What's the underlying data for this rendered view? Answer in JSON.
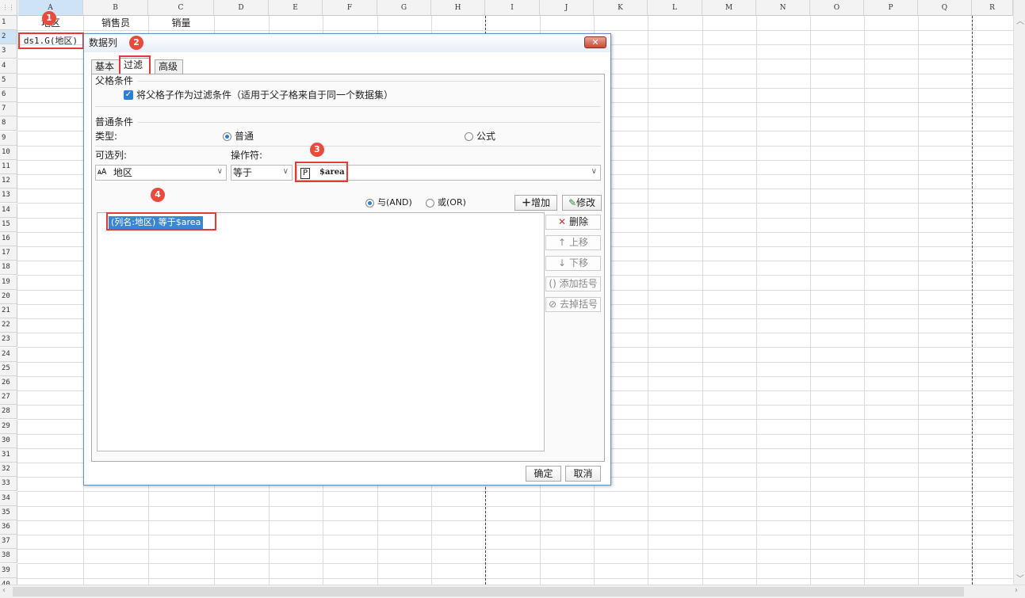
{
  "sheet": {
    "columns": [
      "A",
      "B",
      "C",
      "D",
      "E",
      "F",
      "G",
      "H",
      "I",
      "J",
      "K",
      "L",
      "M",
      "N",
      "O",
      "P",
      "Q",
      "R"
    ],
    "rows": [
      "1",
      "2",
      "3",
      "4",
      "5",
      "6",
      "7",
      "8",
      "9",
      "10",
      "11",
      "12",
      "13",
      "14",
      "15",
      "16",
      "17",
      "18",
      "19",
      "20",
      "21",
      "22",
      "23",
      "24",
      "25",
      "26",
      "27",
      "28",
      "29",
      "30",
      "31",
      "32",
      "33",
      "34",
      "35",
      "36",
      "37",
      "38",
      "39",
      "40"
    ],
    "cells": {
      "a1": "地区",
      "b1": "销售员",
      "c1": "销量",
      "a2": "ds1.G(地区)"
    }
  },
  "badges": {
    "one": "1",
    "two": "2",
    "three": "3",
    "four": "4"
  },
  "dialog": {
    "title": "数据列",
    "close": "✕",
    "tabs": {
      "basic": "基本",
      "filter": "过滤",
      "advanced": "高级"
    },
    "parent_group": "父格条件",
    "parent_checkbox": "将父格子作为过滤条件（适用于父子格来自于同一个数据集）",
    "normal_group": "普通条件",
    "type_label": "类型:",
    "type_normal": "普通",
    "type_formula": "公式",
    "column_label": "可选列:",
    "operator_label": "操作符:",
    "column_value": "地区",
    "operator_value": "等于",
    "value_text": "$area",
    "and_label": "与(AND)",
    "or_label": "或(OR)",
    "add_button": "增加",
    "modify_button": "修改",
    "condition_item": "(列名:地区) 等于$area",
    "side_buttons": {
      "delete": "删除",
      "up": "上移",
      "down": "下移",
      "add_bracket": "添加括号",
      "remove_bracket": "去掉括号"
    },
    "ok": "确定",
    "cancel": "取消"
  }
}
